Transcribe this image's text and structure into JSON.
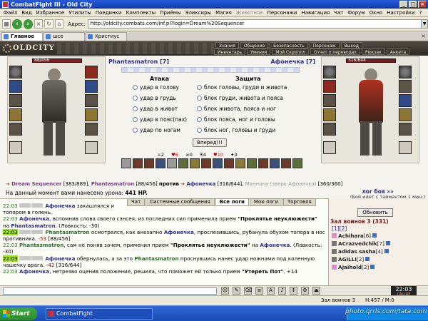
{
  "window": {
    "title": "CombatFight III - Old City"
  },
  "menu": [
    "Файл",
    "Вид",
    "Избранное",
    "Утилиты",
    "Поединки",
    "Комплекты",
    "Приёмы",
    "Эликсиры",
    "Магия",
    "Животное",
    "Персонажи",
    "Навигация",
    "Чат",
    "Форум",
    "Окно",
    "Настройки",
    "?"
  ],
  "toolbar": {
    "address_label": "Адрес:",
    "address": "http://oldcity.combats.com/inf.pl?login=Dream%20Sequencer"
  },
  "browser_tabs": [
    "Главное",
    "шсе",
    "Христиус"
  ],
  "game_nav": {
    "top": [
      "Знания",
      "Общение",
      "Безопасность",
      "Персонаж",
      "Выход"
    ],
    "bottom": [
      "Инвентарь",
      "Умения",
      "Мой Скроллл",
      "Отчет о переводах",
      "Рюкзак",
      "Анкета"
    ]
  },
  "logo": "OLDCITY",
  "fighters": {
    "left": {
      "name": "Phantasmatron",
      "level": "[7]",
      "hp": "88/456"
    },
    "right": {
      "name": "Афонечка",
      "level": "[7]",
      "hp": "316/644"
    }
  },
  "battle": {
    "attack_header": "Атака",
    "defense_header": "Защита",
    "attacks": [
      "удар в голову",
      "удар в грудь",
      "удар в живот",
      "удар в пояс(пах)",
      "удар по ногам"
    ],
    "defenses": [
      "блок головы, груди и живота",
      "блок груди, живота и пояса",
      "блок живота, пояса и ног",
      "блок пояса, ног и головы",
      "блок ног, головы и груди"
    ],
    "hit_button": "Вперед!!!",
    "counts": [
      "2",
      "6",
      "0",
      "4",
      "10",
      "0"
    ]
  },
  "teams": {
    "left_name": "Dream Sequencer",
    "left_hp": "[383/889],",
    "left_name2": "Phantasmatron",
    "left_hp2": "[88/456]",
    "vs": "против",
    "right_name": "Афонечка",
    "right_hp": "[316/644],",
    "right_name2": "Маннона (зверь Афонечка)",
    "right_hp2": "[360/360]"
  },
  "damage": {
    "text": "На данный момент вами нанесено урона:",
    "value": "441 HP."
  },
  "log_nav": "лог боя »»",
  "timeout": "(Бой идет с таймаутом 1 мин.)",
  "chat_tabs": [
    "Чат",
    "Системные сообщения",
    "Все логи",
    "Мои логи",
    "Торговля"
  ],
  "chat": [
    {
      "t": "22:03",
      "n": "Афонечка",
      "text": "закашлялся и"
    },
    {
      "t": "",
      "n": "",
      "text": "топором в голень."
    },
    {
      "t": "22:03",
      "n": "Афонечка",
      "text": ", вспомнив слова своего сэнсея, из последних сил применила прием",
      "q": "\"Проклятье неуклюжести\"",
      "tail": "на",
      "n2": "Phantasmatron",
      "end": ". (Ловкость: -30)"
    },
    {
      "t": "22:03",
      "n": "Phantasmatron",
      "text": "осмотрелся, как внезапно",
      "n2": "Афонечка",
      "end": ", прослезившись, рубанула обухом топора в нос противника.",
      "neg": "-53",
      "hp": "[88/456]"
    },
    {
      "t": "22:03",
      "n": "Phantasmatron",
      "text": ", сам не поняв зачем, применил прием",
      "q": "\"Проклятье неуклюжести\"",
      "tail": "на",
      "n2": "Афонечка",
      "end": ". (Ловкость: -30)"
    },
    {
      "t": "22:03",
      "n": "Афонечка",
      "text": "обернулась, а за это",
      "n2": "Phantasmatron",
      "end": "проснувшись нанес удар ножнами под коленную чашечку врага.",
      "neg": "-42",
      "hp": "[316/644]"
    },
    {
      "t": "22:03",
      "n": "Афонечка",
      "text": ", нетрезво оценив положение, решила, что поможет ей только прием",
      "q": "\"Утереть Пот\"",
      "end": ". +14"
    }
  ],
  "panel": {
    "refresh": "Обновить",
    "hall": "Зал воинов 3 (331)",
    "pages": "[1][2]",
    "players": [
      {
        "name": "Achihara",
        "lvl": "[6]"
      },
      {
        "name": "ACrazvedchik",
        "lvl": "[7]"
      },
      {
        "name": "adidas sasha",
        "lvl": "[4]"
      },
      {
        "name": "AGILLI",
        "lvl": "[2]"
      },
      {
        "name": "Ajaihold",
        "lvl": "[2]"
      }
    ]
  },
  "clock": {
    "time": "22:03",
    "sub": "ONLINE"
  },
  "status": {
    "left": "Зал воинов 3",
    "mid": "H:457 / M:0"
  },
  "taskbar": {
    "start": "Start",
    "item": "CombatFight"
  },
  "watermark": "photo.qrrls.com/tata.com"
}
